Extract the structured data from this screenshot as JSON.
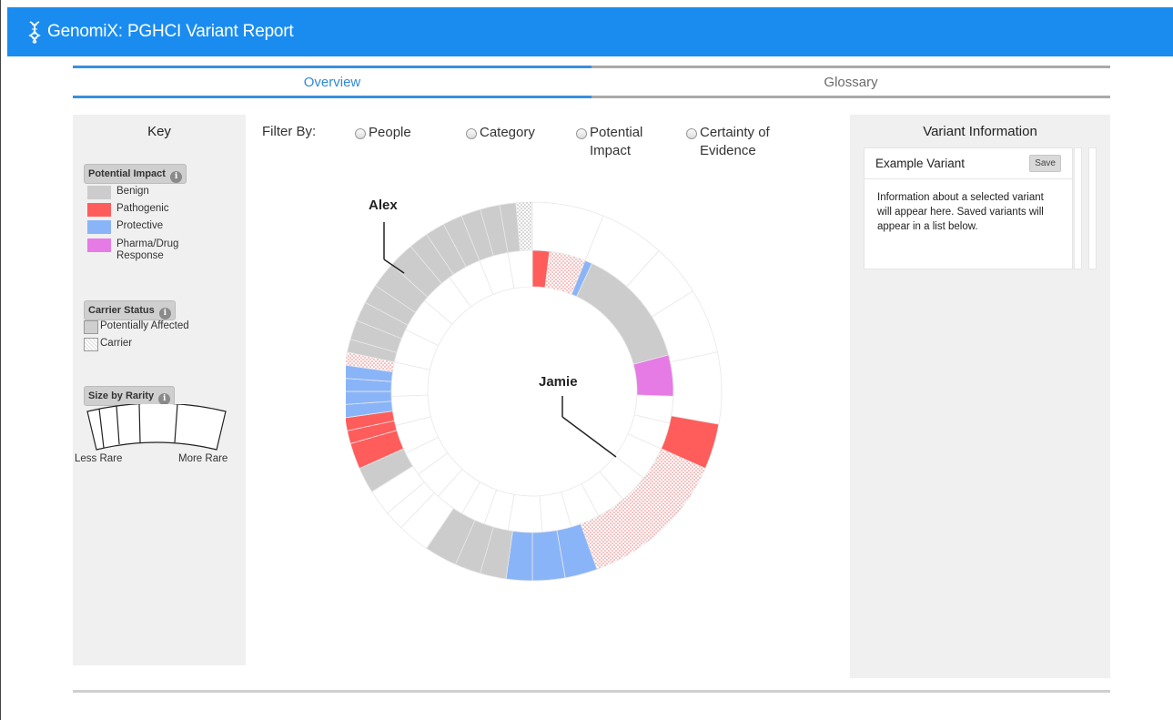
{
  "app": {
    "title": "GenomiX: PGHCI Variant Report"
  },
  "tabs": [
    {
      "label": "Overview",
      "active": true
    },
    {
      "label": "Glossary",
      "active": false
    }
  ],
  "key": {
    "title": "Key",
    "potential_impact": {
      "label": "Potential Impact",
      "items": [
        {
          "label": "Benign",
          "color": "#cccccc"
        },
        {
          "label": "Pathogenic",
          "color": "#ff5c5c"
        },
        {
          "label": "Protective",
          "color": "#8ab4f8"
        },
        {
          "label": "Pharma/Drug Response",
          "color": "#e67be6"
        }
      ]
    },
    "carrier_status": {
      "label": "Carrier Status",
      "items": [
        {
          "label": "Potentially Affected"
        },
        {
          "label": "Carrier"
        }
      ]
    },
    "size_by_rarity": {
      "label": "Size by Rarity",
      "less": "Less Rare",
      "more": "More Rare"
    }
  },
  "filters": {
    "label": "Filter By:",
    "options": [
      {
        "label": "People"
      },
      {
        "label": "Category"
      },
      {
        "label": "Potential Impact"
      },
      {
        "label": "Certainty of Evidence"
      }
    ]
  },
  "chart_data": {
    "type": "sunburst",
    "people": [
      {
        "name": "Alex",
        "ring": "outer"
      },
      {
        "name": "Jamie",
        "ring": "inner"
      }
    ]
  },
  "variant_info": {
    "title": "Variant Information",
    "card_title": "Example Variant",
    "save_label": "Save",
    "body": "Information about a selected variant will appear here. Saved variants will appear in a list below."
  }
}
